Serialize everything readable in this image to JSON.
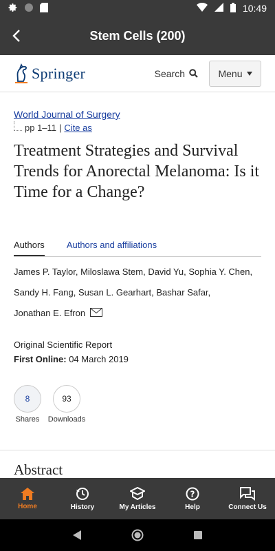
{
  "status_bar": {
    "time": "10:49"
  },
  "app_bar": {
    "title": "Stem Cells (200)"
  },
  "header": {
    "logo_text": "Springer",
    "search_label": "Search",
    "menu_label": "Menu"
  },
  "article": {
    "journal": "World Journal of Surgery",
    "pages": "pp 1–11",
    "separator": "|",
    "cite_label": "Cite as",
    "title": "Treatment Strategies and Survival Trends for Anorectal Melanoma: Is it Time for a Change?",
    "tabs": [
      "Authors",
      "Authors and affiliations"
    ],
    "authors_line1": "James P. Taylor, Miloslawa Stem, David Yu, Sophia Y. Chen,",
    "authors_line2": "Sandy H. Fang, Susan L. Gearhart, Bashar Safar,",
    "authors_line3": "Jonathan E. Efron",
    "report_type": "Original Scientific Report",
    "first_online_label": "First Online:",
    "first_online_date": "04 March 2019",
    "metrics": {
      "shares_value": "8",
      "shares_label": "Shares",
      "downloads_value": "93",
      "downloads_label": "Downloads"
    },
    "abstract_heading": "Abstract"
  },
  "bottom_nav": [
    {
      "label": "Home",
      "icon": "home-icon",
      "active": true
    },
    {
      "label": "History",
      "icon": "history-icon"
    },
    {
      "label": "My Articles",
      "icon": "my-articles-icon"
    },
    {
      "label": "Help",
      "icon": "help-icon"
    },
    {
      "label": "Connect Us",
      "icon": "chat-icon"
    }
  ],
  "colors": {
    "bar_bg": "#3a3a3a",
    "accent": "#f07c22",
    "link": "#1a3fa0",
    "brand": "#0b3a73"
  }
}
